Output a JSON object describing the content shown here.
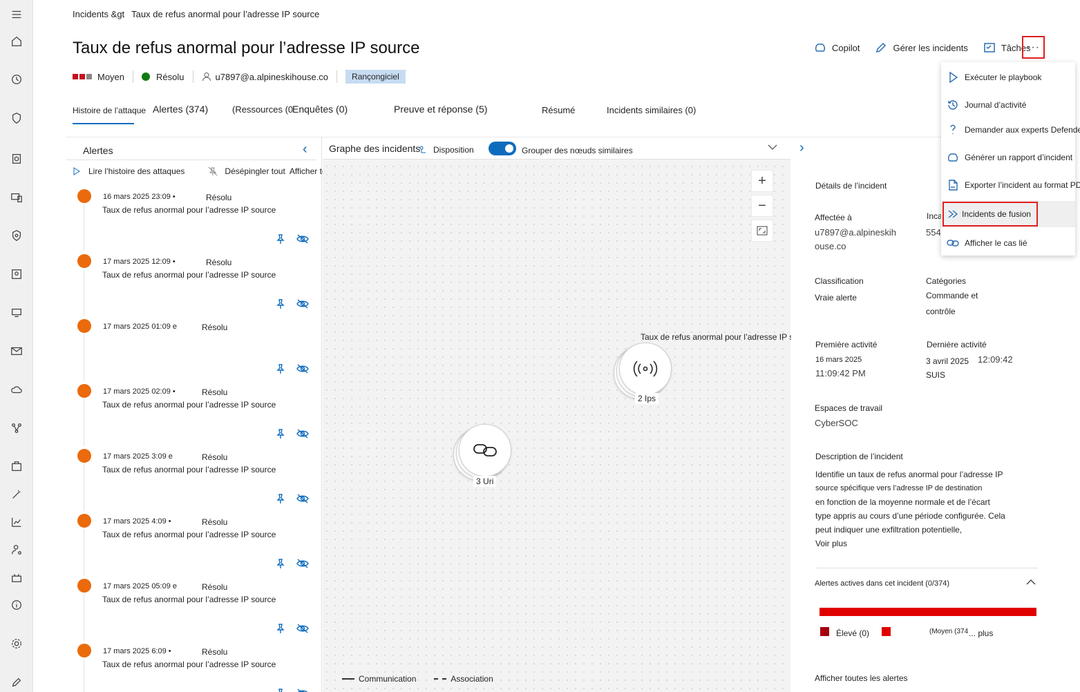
{
  "breadcrumb": [
    "Incidents &gt",
    "Taux de refus anormal pour l’adresse IP source"
  ],
  "title": "Taux de refus anormal pour l’adresse IP source",
  "meta": {
    "severity": "Moyen",
    "status": "Résolu",
    "assignee": "u7897@a.alpineskihouse.co",
    "tag": "Rançongiciel",
    "severity_colors": [
      "#c50f1f",
      "#c50f1f",
      "#8a8886"
    ],
    "status_color": "#107c10"
  },
  "actions": {
    "copilot": "Copilot",
    "manage": "Gérer les incidents",
    "tasks": "Tâches",
    "more": "···"
  },
  "tabs": [
    "Histoire de l’attaque",
    "Alertes (374)",
    "(Ressources (0",
    "Enquêtes (0)",
    "Preuve et réponse (5)",
    "Résumé",
    "Incidents similaires (0)"
  ],
  "alerts_panel": {
    "title": "Alertes",
    "play": "Lire l’histoire des attaques",
    "unpin": "Désépingler tout",
    "show_all": "Afficher tout",
    "items": [
      {
        "date": "16 mars 2025 23:09 •",
        "status": "Résolu",
        "title": "Taux de refus anormal pour l’adresse IP source"
      },
      {
        "date": "17 mars 2025 12:09 •",
        "status": "Résolu",
        "title": "Taux de refus anormal pour l’adresse IP source"
      },
      {
        "date": "17 mars 2025 01:09 e",
        "status": "Résolu",
        "title": ""
      },
      {
        "date": "17 mars 2025 02:09 •",
        "status": "Résolu",
        "title": "Taux de refus anormal pour l’adresse IP source"
      },
      {
        "date": "17 mars 2025 3:09 e",
        "status": "Résolu",
        "title": "Taux de refus anormal pour l’adresse IP source"
      },
      {
        "date": "17 mars 2025 4:09 •",
        "status": "Résolu",
        "title": "Taux de refus anormal pour l’adresse IP source"
      },
      {
        "date": "17 mars 2025 05:09 e",
        "status": "Résolu",
        "title": "Taux de refus anormal pour l’adresse IP source"
      },
      {
        "date": "17 mars 2025 6:09 •",
        "status": "Résolu",
        "title": "Taux de refus anormal pour l’adresse IP source"
      }
    ]
  },
  "graph": {
    "title": "Graphe des incidents",
    "layout": "Disposition",
    "group": "Grouper des nœuds similaires",
    "node_ip": {
      "label": "Taux de refus anormal pour l’adresse IP source",
      "count": "2",
      "type": "Ips"
    },
    "node_url": {
      "count": "3",
      "type": "Uri"
    },
    "legend": [
      "Communication",
      "Association"
    ]
  },
  "details": {
    "section": "Détails de l’incident",
    "assigned_label": "Affectée à",
    "assigned_1": "u7897@a.alpineskih",
    "assigned_2": "ouse.co",
    "incident_label": "Inca",
    "incident_value": "554",
    "classification_label": "Classification",
    "classification_value": "Vraie alerte",
    "categories_label": "Catégories",
    "categories_1": "Commande et",
    "categories_2": "contrôle",
    "first_label": "Première activité",
    "first_date": "16 mars 2025",
    "first_time": "11:09:42 PM",
    "last_label": "Dernière activité",
    "last_date": "3 avril 2025",
    "last_time": "12:09:42",
    "last_suffix": "SUIS",
    "workspace_label": "Espaces de travail",
    "workspace_value": "CyberSOC",
    "desc_label": "Description de l’incident",
    "desc_lines": [
      "Identifie un taux de refus anormal pour l’adresse IP",
      "source spécifique vers l’adresse IP de destination",
      "en fonction de la moyenne normale et de l’écart",
      "type appris au cours d’une période configurée. Cela",
      "peut indiquer une exfiltration potentielle,"
    ],
    "see_more": "Voir plus",
    "active_alerts": "Alertes actives dans cet incident (0/374)",
    "high": "Élevé (0)",
    "medium": "(Moyen (374",
    "more_suffix": "... plus",
    "show_all_alerts": "Afficher toutes les alertes",
    "colors": {
      "bar": "#e00000",
      "high": "#a4000f",
      "medium": "#e00000"
    }
  },
  "menu": {
    "items": [
      "Exécuter le playbook",
      "Journal d’activité",
      "Demander aux experts Defender",
      "Générer un rapport d’incident",
      "Exporter l’incident au format PDF",
      "Incidents de fusion",
      "Afficher le cas lié"
    ]
  }
}
